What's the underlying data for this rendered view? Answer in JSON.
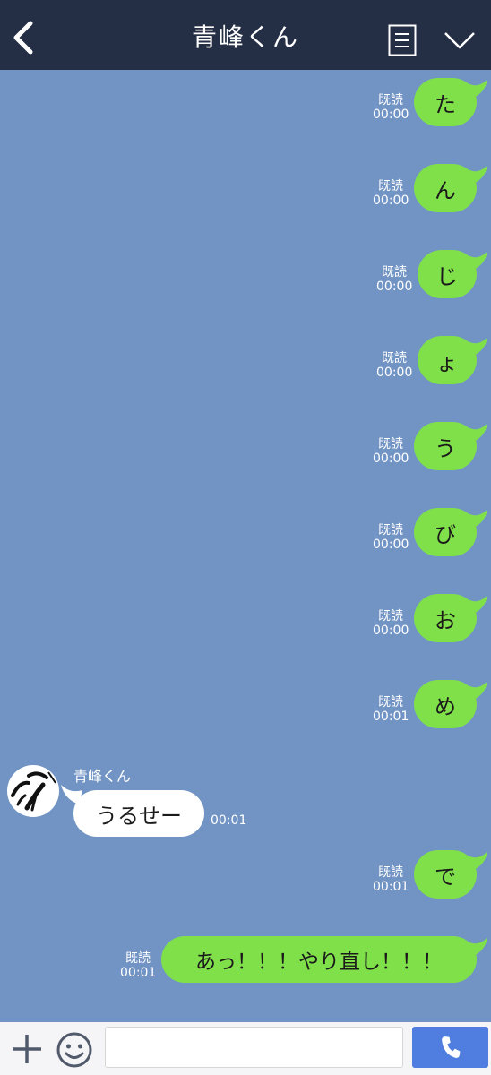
{
  "header": {
    "title": "青峰くん",
    "back_icon": "chevron-left-icon",
    "menu_icon": "list-icon",
    "expand_icon": "chevron-down-icon"
  },
  "messages": [
    {
      "read": "既読",
      "time": "00:00",
      "text": "た"
    },
    {
      "read": "既読",
      "time": "00:00",
      "text": "ん"
    },
    {
      "read": "既読",
      "time": "00:00",
      "text": "じ"
    },
    {
      "read": "既読",
      "time": "00:00",
      "text": "ょ"
    },
    {
      "read": "既読",
      "time": "00:00",
      "text": "う"
    },
    {
      "read": "既読",
      "time": "00:00",
      "text": "び"
    },
    {
      "read": "既読",
      "time": "00:00",
      "text": "お"
    },
    {
      "read": "既読",
      "time": "00:01",
      "text": "め"
    },
    {
      "read": "既読",
      "time": "00:01",
      "text": "で"
    },
    {
      "read": "既読",
      "time": "00:01",
      "text": "あっ！！！やり直し！！！"
    }
  ],
  "incoming": {
    "sender": "青峰くん",
    "text": "うるせー",
    "time": "00:01"
  },
  "footer": {
    "plus_icon": "plus-icon",
    "emoji_icon": "smiley-icon",
    "input_value": "",
    "call_icon": "phone-icon"
  },
  "colors": {
    "background": "#7194c4",
    "header": "#242e44",
    "outgoing_bubble": "#80e04a",
    "incoming_bubble": "#ffffff",
    "call_button": "#4f7de0"
  }
}
